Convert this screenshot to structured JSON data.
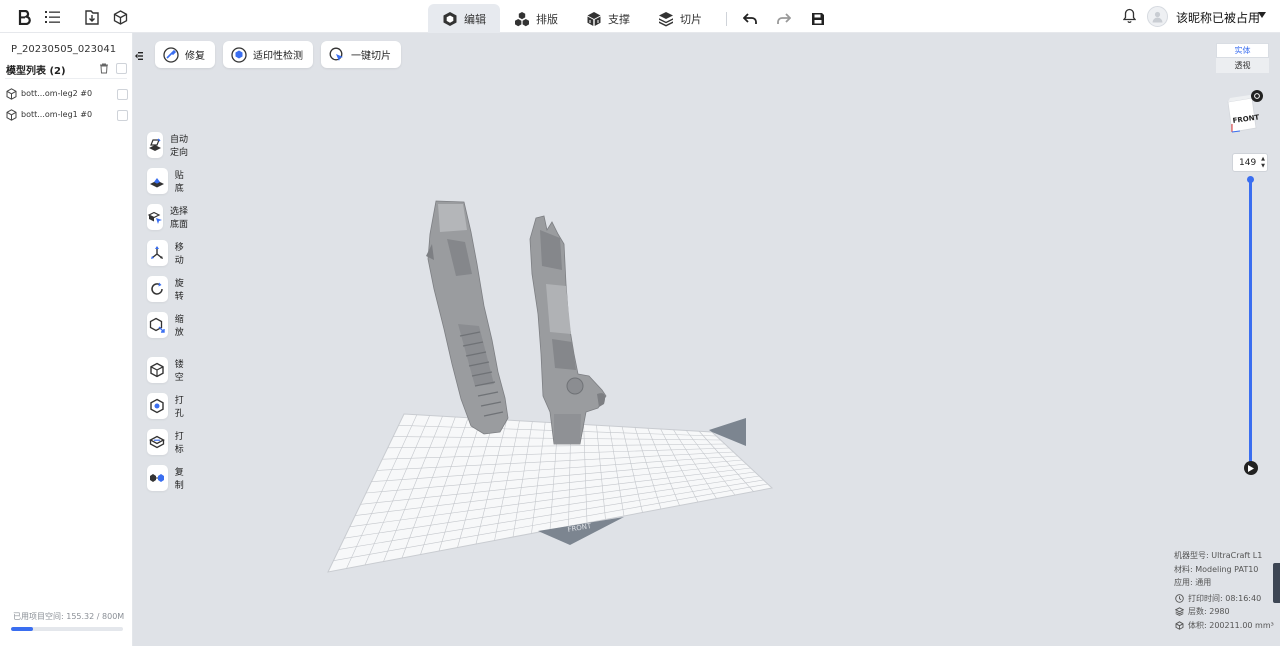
{
  "topbar": {
    "tabs": [
      {
        "label": "编辑",
        "icon": "edit-cube-icon",
        "active": true
      },
      {
        "label": "排版",
        "icon": "layout-icon",
        "active": false
      },
      {
        "label": "支撑",
        "icon": "support-icon",
        "active": false
      },
      {
        "label": "切片",
        "icon": "slice-icon",
        "active": false
      }
    ],
    "username": "该昵称已被占用"
  },
  "sidebar": {
    "project_name": "P_20230505_023041",
    "model_list_title": "模型列表 (2)",
    "models": [
      {
        "name": "bott...om-leg2 #0"
      },
      {
        "name": "bott...om-leg1 #0"
      }
    ],
    "space_used_label": "已用项目空间: 155.32 / 800M",
    "space_used_fraction": 0.194
  },
  "toolbar_top": [
    {
      "label": "修复",
      "icon": "repair-icon"
    },
    {
      "label": "适印性检测",
      "icon": "printability-check-icon"
    },
    {
      "label": "一键切片",
      "icon": "one-click-slice-icon"
    }
  ],
  "tools_left": [
    {
      "label": "自动定向",
      "icon": "auto-orient-icon"
    },
    {
      "label": "贴底",
      "icon": "lay-flat-icon"
    },
    {
      "label": "选择底面",
      "icon": "select-bottom-icon"
    },
    {
      "label": "移动",
      "icon": "move-icon"
    },
    {
      "label": "旋转",
      "icon": "rotate-icon"
    },
    {
      "label": "缩放",
      "icon": "scale-icon"
    },
    {
      "label": "镂空",
      "icon": "hollow-icon"
    },
    {
      "label": "打孔",
      "icon": "punch-hole-icon"
    },
    {
      "label": "打标",
      "icon": "label-icon"
    },
    {
      "label": "复制",
      "icon": "duplicate-icon"
    }
  ],
  "view_mode": {
    "solid": "实体",
    "transparent": "透视",
    "active": "solid"
  },
  "view_cube_label": "FRONT",
  "platform_label": "FRONT",
  "layer": {
    "value": "149"
  },
  "info": {
    "machine": "机器型号: UltraCraft L1",
    "material": "材料: Modeling PAT10",
    "application": "应用: 通用",
    "print_time": "打印时间: 08:16:40",
    "layers": "层数: 2980",
    "volume": "体积: 200211.00 mm³"
  },
  "colors": {
    "accent": "#3a6ef0",
    "viewport_bg": "#dfe2e7",
    "model_gray": "#9a9c9f"
  }
}
